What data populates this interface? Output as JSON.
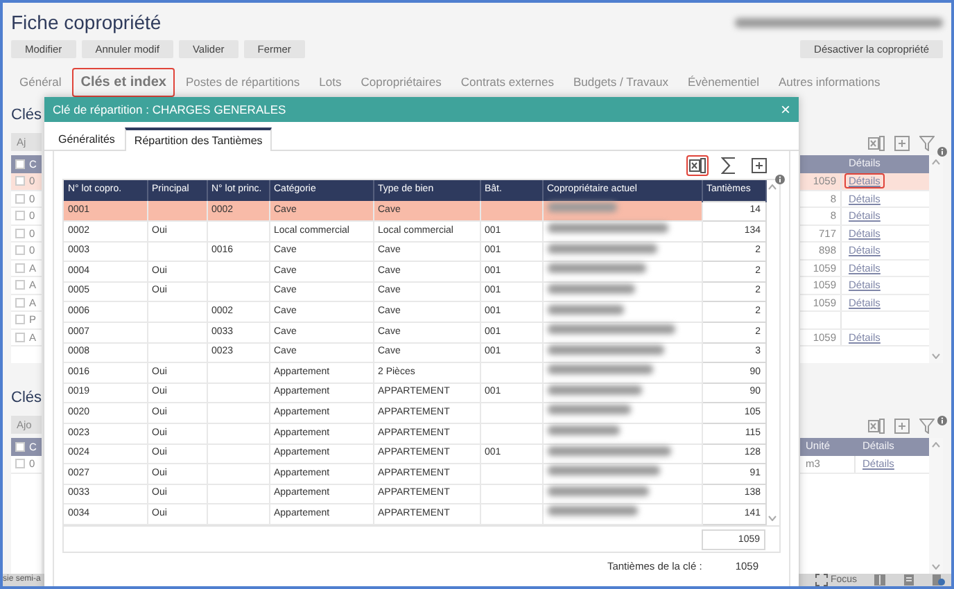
{
  "window": {
    "title": "Fiche copropriété"
  },
  "toolbar": {
    "buttons": [
      "Modifier",
      "Annuler modif",
      "Valider",
      "Fermer"
    ],
    "right_button": "Désactiver la copropriété"
  },
  "tabs": [
    {
      "label": "Général",
      "selected": false,
      "annotated": false
    },
    {
      "label": "Clés et index",
      "selected": true,
      "annotated": true
    },
    {
      "label": "Postes de répartitions",
      "selected": false,
      "annotated": false
    },
    {
      "label": "Lots",
      "selected": false,
      "annotated": false
    },
    {
      "label": "Copropriétaires",
      "selected": false,
      "annotated": false
    },
    {
      "label": "Contrats externes",
      "selected": false,
      "annotated": false
    },
    {
      "label": "Budgets / Travaux",
      "selected": false,
      "annotated": false
    },
    {
      "label": "Évènementiel",
      "selected": false,
      "annotated": false
    },
    {
      "label": "Autres informations",
      "selected": false,
      "annotated": false
    }
  ],
  "sections": [
    {
      "kind": "amounts",
      "heading": "Clés",
      "add_button": "Aj",
      "left_header": "C",
      "header_checked": false,
      "link_header": "Détails",
      "rows": [
        {
          "first": "0",
          "value": "1059",
          "link": "Détails",
          "checked": false,
          "selected": true,
          "annotated": true
        },
        {
          "first": "0",
          "value": "8",
          "link": "Détails",
          "checked": false,
          "selected": false,
          "annotated": false
        },
        {
          "first": "0",
          "value": "8",
          "link": "Détails",
          "checked": false,
          "selected": false,
          "annotated": false
        },
        {
          "first": "0",
          "value": "717",
          "link": "Détails",
          "checked": false,
          "selected": false,
          "annotated": false
        },
        {
          "first": "0",
          "value": "898",
          "link": "Détails",
          "checked": false,
          "selected": false,
          "annotated": false
        },
        {
          "first": "A",
          "value": "1059",
          "link": "Détails",
          "checked": false,
          "selected": false,
          "annotated": false
        },
        {
          "first": "A",
          "value": "1059",
          "link": "Détails",
          "checked": false,
          "selected": false,
          "annotated": false
        },
        {
          "first": "A",
          "value": "1059",
          "link": "Détails",
          "checked": false,
          "selected": false,
          "annotated": false
        },
        {
          "first": "P",
          "checked": false,
          "selected": false
        },
        {
          "first": "A",
          "value": "1059",
          "link": "Détails",
          "checked": false,
          "selected": false,
          "annotated": false
        }
      ]
    },
    {
      "kind": "units",
      "heading": "Clés",
      "add_button": "Ajo",
      "left_header": "C",
      "header_checked": false,
      "value_header": "Unité",
      "link_header": "Détails",
      "rows": [
        {
          "first": "0",
          "value": "m3",
          "link": "Détails",
          "checked": false,
          "selected": false,
          "annotated": false
        }
      ]
    }
  ],
  "status_bar": {
    "left": "sie semi-a",
    "focus": "Focus"
  },
  "modal": {
    "title": "Clé de répartition : CHARGES GENERALES",
    "close": "×",
    "tabs": [
      {
        "label": "Généralités",
        "selected": false
      },
      {
        "label": "Répartition des Tantièmes",
        "selected": true
      }
    ],
    "tools": [
      {
        "kind": "excel",
        "annotated": true
      },
      {
        "kind": "sum",
        "annotated": false
      },
      {
        "kind": "add",
        "annotated": false
      }
    ],
    "columns": [
      "N° lot copro.",
      "Principal",
      "N° lot princ.",
      "Catégorie",
      "Type de bien",
      "Bât.",
      "Copropriétaire actuel",
      "Tantièmes"
    ],
    "rows": [
      {
        "lot": "0001",
        "lot_princ": "0002",
        "categorie": "Cave",
        "type": "Cave",
        "tantiemes": "14",
        "selected": true
      },
      {
        "lot": "0002",
        "principal": "Oui",
        "categorie": "Local commercial",
        "type": "Local commercial",
        "bat": "001",
        "tantiemes": "134",
        "selected": false
      },
      {
        "lot": "0003",
        "lot_princ": "0016",
        "categorie": "Cave",
        "type": "Cave",
        "bat": "001",
        "tantiemes": "2",
        "selected": false
      },
      {
        "lot": "0004",
        "principal": "Oui",
        "categorie": "Cave",
        "type": "Cave",
        "bat": "001",
        "tantiemes": "2",
        "selected": false
      },
      {
        "lot": "0005",
        "principal": "Oui",
        "categorie": "Cave",
        "type": "Cave",
        "bat": "001",
        "tantiemes": "2",
        "selected": false
      },
      {
        "lot": "0006",
        "lot_princ": "0002",
        "categorie": "Cave",
        "type": "Cave",
        "bat": "001",
        "tantiemes": "2",
        "selected": false
      },
      {
        "lot": "0007",
        "lot_princ": "0033",
        "categorie": "Cave",
        "type": "Cave",
        "bat": "001",
        "tantiemes": "2",
        "selected": false
      },
      {
        "lot": "0008",
        "lot_princ": "0023",
        "categorie": "Cave",
        "type": "Cave",
        "bat": "001",
        "tantiemes": "3",
        "selected": false
      },
      {
        "lot": "0016",
        "principal": "Oui",
        "categorie": "Appartement",
        "type": "2 Pièces",
        "tantiemes": "90",
        "selected": false
      },
      {
        "lot": "0019",
        "principal": "Oui",
        "categorie": "Appartement",
        "type": "APPARTEMENT",
        "bat": "001",
        "tantiemes": "90",
        "selected": false
      },
      {
        "lot": "0020",
        "principal": "Oui",
        "categorie": "Appartement",
        "type": "APPARTEMENT",
        "tantiemes": "105",
        "selected": false
      },
      {
        "lot": "0023",
        "principal": "Oui",
        "categorie": "Appartement",
        "type": "APPARTEMENT",
        "tantiemes": "115",
        "selected": false
      },
      {
        "lot": "0024",
        "principal": "Oui",
        "categorie": "Appartement",
        "type": "APPARTEMENT",
        "bat": "001",
        "tantiemes": "128",
        "selected": false
      },
      {
        "lot": "0027",
        "principal": "Oui",
        "categorie": "Appartement",
        "type": "APPARTEMENT",
        "tantiemes": "91",
        "selected": false
      },
      {
        "lot": "0033",
        "principal": "Oui",
        "categorie": "Appartement",
        "type": "APPARTEMENT",
        "tantiemes": "138",
        "selected": false
      },
      {
        "lot": "0034",
        "principal": "Oui",
        "categorie": "Appartement",
        "type": "APPARTEMENT",
        "tantiemes": "141",
        "selected": false
      }
    ],
    "total": "1059",
    "key_label": "Tantièmes de la clé :",
    "key_value": "1059"
  }
}
